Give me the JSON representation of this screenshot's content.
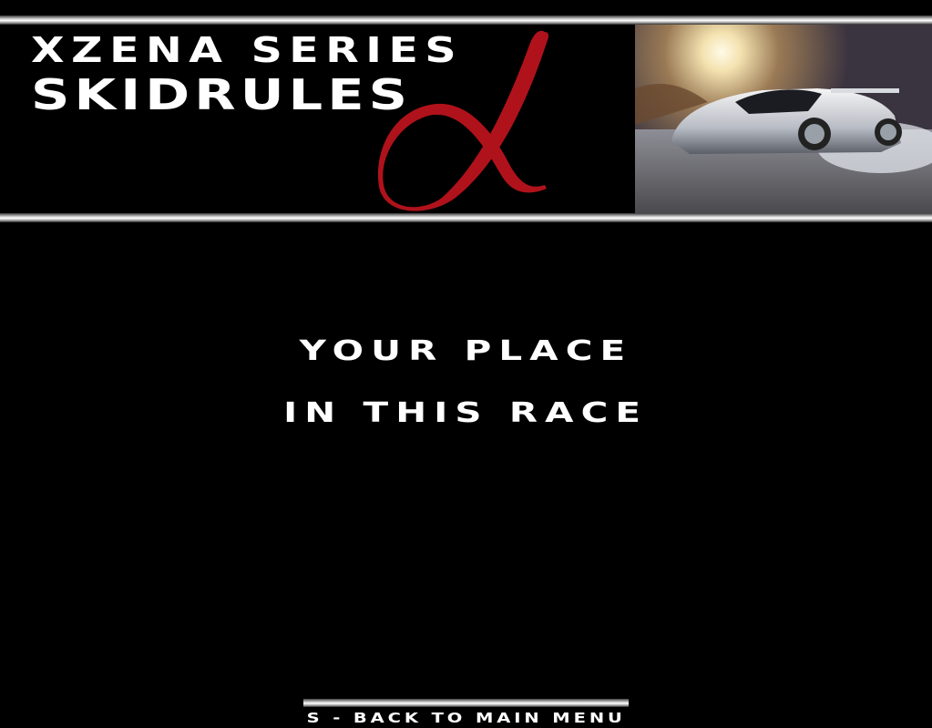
{
  "header": {
    "series_label": "XZENA SERIES",
    "game_title": "SKIDRULES",
    "logo": "alpha-logo",
    "banner_image": "race-car-image"
  },
  "main": {
    "line_1": "YOUR PLACE",
    "line_2": "IN THIS RACE"
  },
  "footer": {
    "back_label": "S - BACK TO MAIN MENU"
  },
  "colors": {
    "background": "#000000",
    "text": "#ffffff",
    "logo_red": "#b0121b"
  }
}
